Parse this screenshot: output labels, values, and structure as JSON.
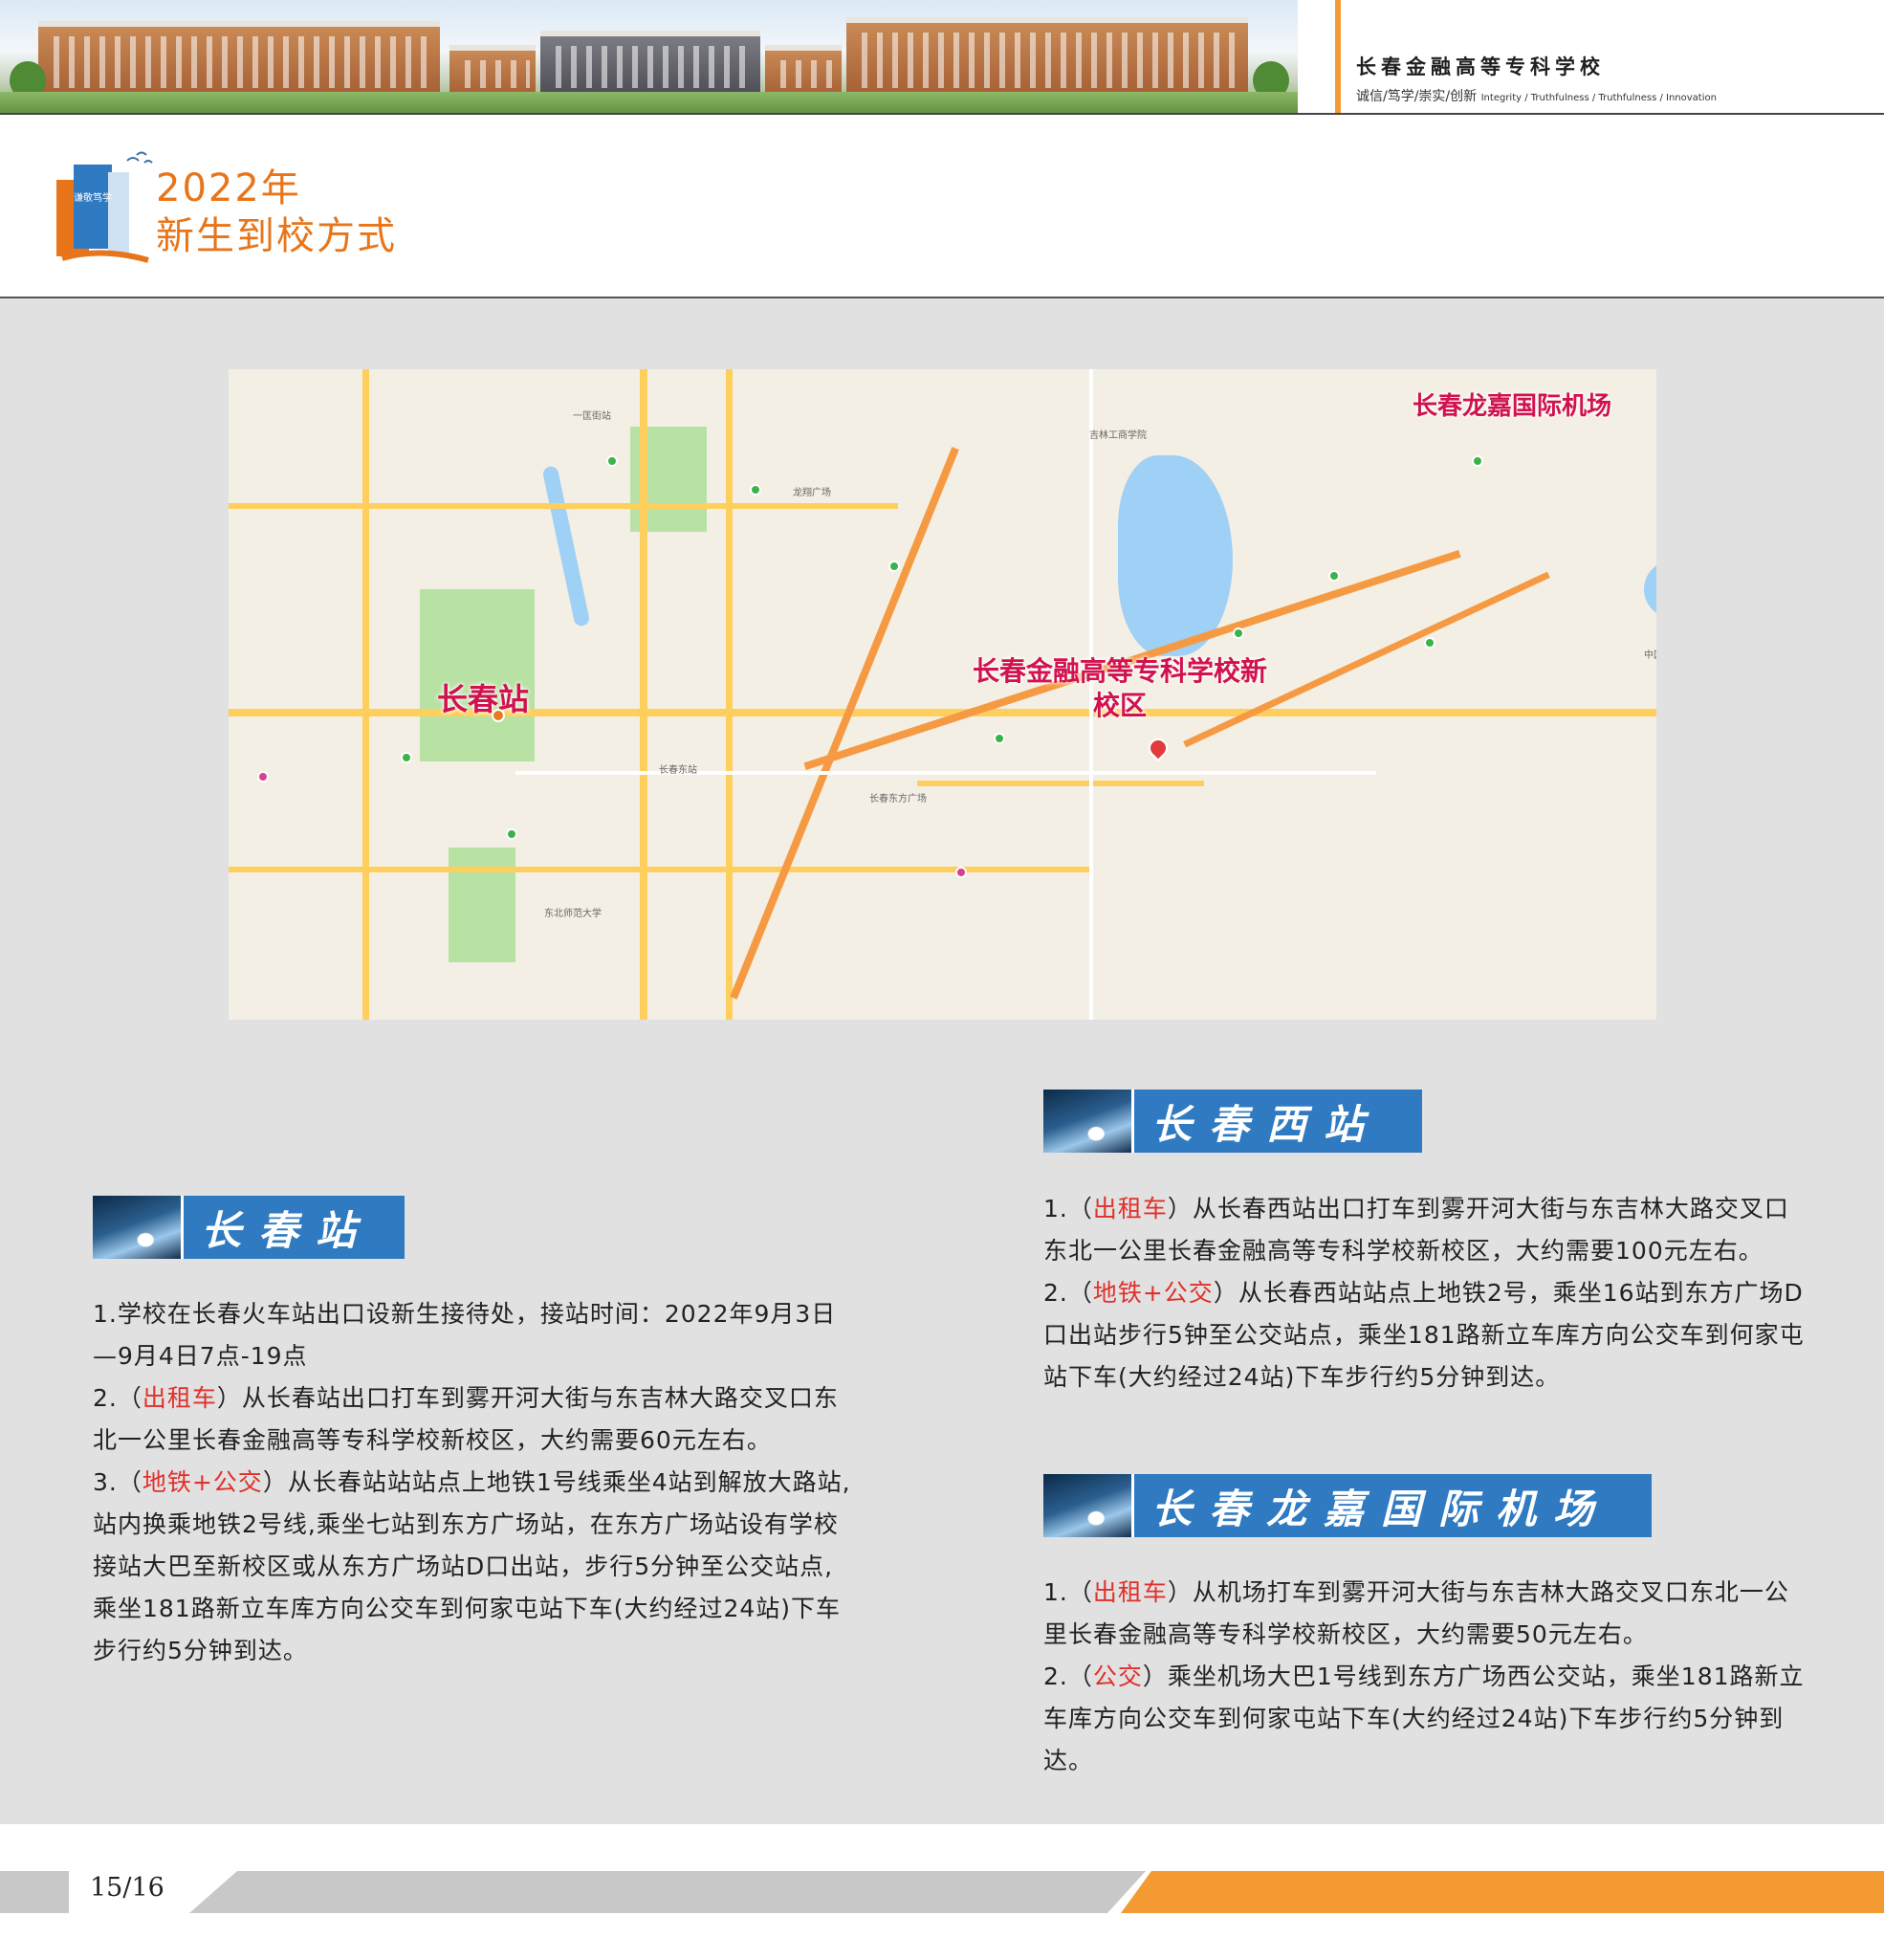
{
  "header": {
    "school_name": "长春金融高等专科学校",
    "motto_cn": "诚信/笃学/崇实/创新",
    "motto_en": "Integrity / Truthfulness / Truthfulness / Innovation"
  },
  "title": {
    "year": "2022年",
    "subtitle": "新生到校方式",
    "icon_text": "谦敬笃学"
  },
  "map": {
    "airport_label": "长春龙嘉国际机场",
    "station_label": "长春站",
    "campus_label_line1": "长春金融高等专科学校新",
    "campus_label_line2": "校区"
  },
  "sections": {
    "changchun_station": {
      "title": "长春站",
      "item1": "1.学校在长春火车站出口设新生接待处，接站时间：2022年9月3日—9月4日7点-19点",
      "item2_prefix": "2.（",
      "item2_tag": "出租车",
      "item2_text": "）从长春站出口打车到雾开河大街与东吉林大路交叉口东北一公里长春金融高等专科学校新校区，大约需要60元左右。",
      "item3_prefix": "3.（",
      "item3_tag": "地铁+公交",
      "item3_text": "）从长春站站站点上地铁1号线乘坐4站到解放大路站,站内换乘地铁2号线,乘坐七站到东方广场站，在东方广场站设有学校接站大巴至新校区或从东方广场站D口出站，步行5分钟至公交站点,乘坐181路新立车库方向公交车到何家屯站下车(大约经过24站)下车步行约5分钟到达。"
    },
    "changchun_west": {
      "title": "长春西站",
      "item1_prefix": "1.（",
      "item1_tag": "出租车",
      "item1_text": "）从长春西站出口打车到雾开河大街与东吉林大路交叉口东北一公里长春金融高等专科学校新校区，大约需要100元左右。",
      "item2_prefix": "2.（",
      "item2_tag": "地铁+公交",
      "item2_text": "）从长春西站站点上地铁2号，乘坐16站到东方广场D口出站步行5钟至公交站点，乘坐181路新立车库方向公交车到何家屯站下车(大约经过24站)下车步行约5分钟到达。"
    },
    "airport": {
      "title": "长春龙嘉国际机场",
      "item1_prefix": "1.（",
      "item1_tag": "出租车",
      "item1_text": "）从机场打车到雾开河大街与东吉林大路交叉口东北一公里长春金融高等专科学校新校区，大约需要50元左右。",
      "item2_prefix": "2.（",
      "item2_tag": "公交",
      "item2_text": "）乘坐机场大巴1号线到东方广场西公交站，乘坐181路新立车库方向公交车到何家屯站下车(大约经过24站)下车步行约5分钟到达。"
    }
  },
  "footer": {
    "page": "15/16"
  },
  "colors": {
    "accent_orange": "#e8751a",
    "badge_blue": "#2f7ac1",
    "highlight_red": "#e0302a",
    "map_label": "#d1124f"
  }
}
